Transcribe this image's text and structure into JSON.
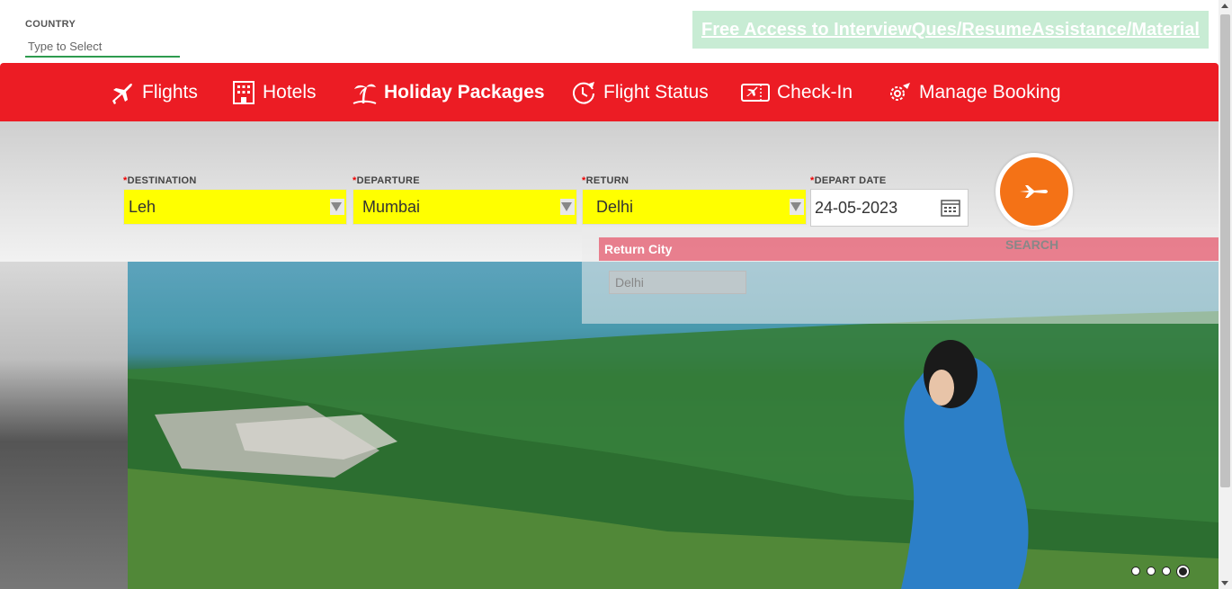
{
  "header": {
    "country_label": "COUNTRY",
    "country_placeholder": "Type to Select",
    "promo_link": "Free Access to InterviewQues/ResumeAssistance/Material"
  },
  "nav": {
    "items": [
      {
        "label": "Flights",
        "icon": "airplane-icon"
      },
      {
        "label": "Hotels",
        "icon": "hotel-building-icon"
      },
      {
        "label": "Holiday Packages",
        "icon": "palm-tree-icon",
        "active": true
      },
      {
        "label": "Flight Status",
        "icon": "clock-plane-icon"
      },
      {
        "label": "Check-In",
        "icon": "boarding-pass-icon"
      },
      {
        "label": "Manage Booking",
        "icon": "gear-plane-icon"
      }
    ]
  },
  "search": {
    "required_mark": "*",
    "destination_label": "DESTINATION",
    "destination_value": "Leh",
    "departure_label": "DEPARTURE",
    "departure_value": "Mumbai",
    "return_label": "RETURN",
    "return_value": "Delhi",
    "depart_date_label": "DEPART DATE",
    "depart_date_value": "24-05-2023",
    "search_label": "SEARCH"
  },
  "dropdown": {
    "title": "Return City",
    "options": [
      "Delhi"
    ]
  },
  "carousel": {
    "slide_count": 4,
    "active_index": 3
  },
  "colors": {
    "nav_background": "#ec1c24",
    "select_highlight": "#ffff00",
    "search_button": "#f47216",
    "promo_background": "#c8ecd4"
  }
}
